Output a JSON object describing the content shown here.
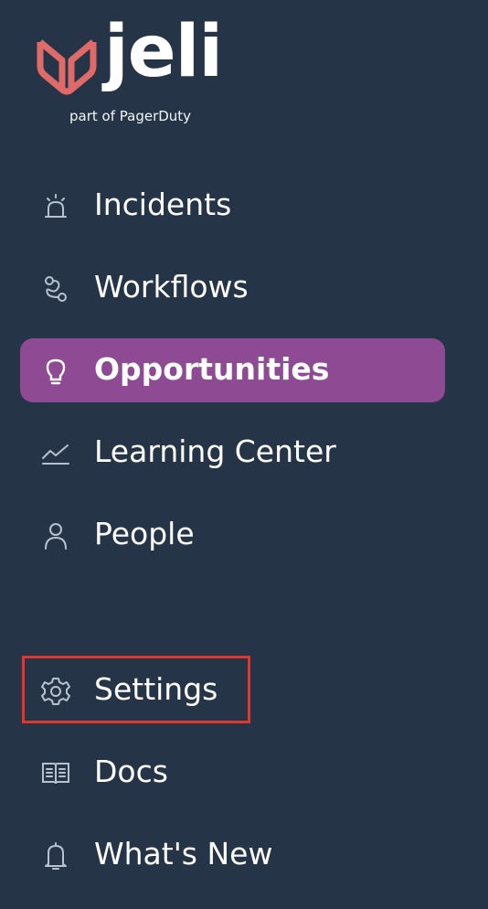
{
  "brand": {
    "name": "jeli",
    "tagline": "part of PagerDuty"
  },
  "colors": {
    "background": "#253547",
    "active_item": "#8e4a93",
    "logo_accent": "#e06a68",
    "highlight_box": "#e3362a"
  },
  "nav": {
    "primary": [
      {
        "label": "Incidents",
        "icon": "siren-icon",
        "active": false
      },
      {
        "label": "Workflows",
        "icon": "workflow-icon",
        "active": false
      },
      {
        "label": "Opportunities",
        "icon": "lightbulb-icon",
        "active": true
      },
      {
        "label": "Learning Center",
        "icon": "trend-chart-icon",
        "active": false
      },
      {
        "label": "People",
        "icon": "person-icon",
        "active": false
      }
    ],
    "secondary": [
      {
        "label": "Settings",
        "icon": "gear-icon",
        "active": false,
        "highlighted": true
      },
      {
        "label": "Docs",
        "icon": "book-icon",
        "active": false
      },
      {
        "label": "What's New",
        "icon": "bell-icon",
        "active": false
      }
    ]
  }
}
